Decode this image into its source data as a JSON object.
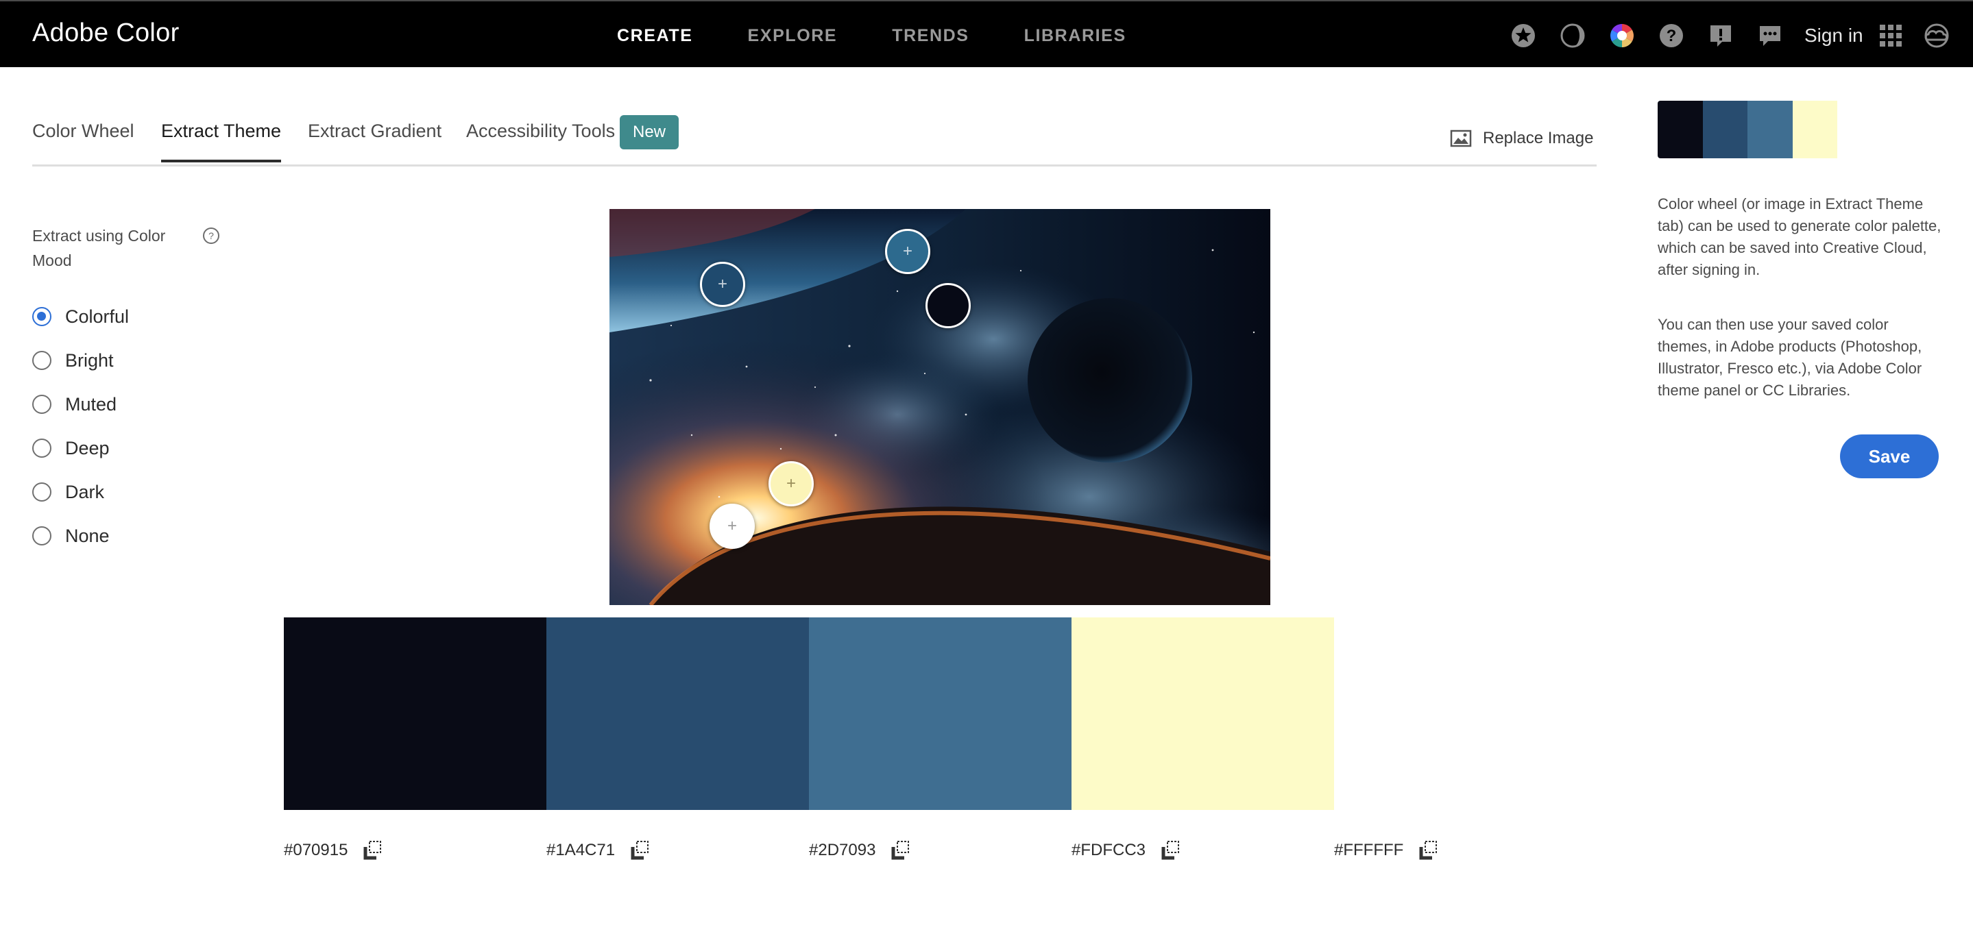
{
  "app": {
    "brand": "Adobe Color",
    "nav": [
      "CREATE",
      "EXPLORE",
      "TRENDS",
      "LIBRARIES"
    ],
    "active_nav": "CREATE",
    "toolbar_icons": [
      "star-icon",
      "contrast-icon",
      "color-wheel-icon",
      "help-icon",
      "alert-icon",
      "feedback-icon"
    ],
    "sign_in": "Sign in",
    "grid_icon": "apps-grid-icon",
    "creative_cloud_icon": "creative-cloud-icon"
  },
  "tabs": [
    {
      "label": "Color Wheel",
      "active": false
    },
    {
      "label": "Extract Theme",
      "active": true
    },
    {
      "label": "Extract Gradient",
      "active": false
    },
    {
      "label": "Accessibility Tools",
      "active": false
    }
  ],
  "new_badge": "New",
  "replace_image": "Replace Image",
  "mood": {
    "title": "Extract using Color Mood",
    "help_icon": "help-circle-icon",
    "options": [
      "Colorful",
      "Bright",
      "Muted",
      "Deep",
      "Dark",
      "None"
    ],
    "selected": "Colorful"
  },
  "swatches": [
    {
      "hex": "#070915",
      "color": "#090b16"
    },
    {
      "hex": "#1A4C71",
      "color": "#284c6f"
    },
    {
      "hex": "#2D7093",
      "color": "#3f6e91"
    },
    {
      "hex": "#FDFCC3",
      "color": "#fdfbc8"
    },
    {
      "hex": "#FFFFFF",
      "color": "#ffffff"
    }
  ],
  "mini_palette": [
    "#090b16",
    "#284c6f",
    "#3f6e91",
    "#fdfbc8",
    "#ffffff"
  ],
  "info": {
    "paragraph1": "Color wheel (or image in Extract Theme tab) can be used to generate color palette, which can be saved into Creative Cloud, after signing in.",
    "paragraph2": "You can then use your saved color themes, in Adobe products (Photoshop, Illustrator, Fresco etc.), via Adobe Color theme panel or CC Libraries."
  },
  "save": "Save",
  "colors": {
    "accent": "#2d6fd6",
    "badge": "#3f8a8c",
    "topbar": "#000000"
  }
}
